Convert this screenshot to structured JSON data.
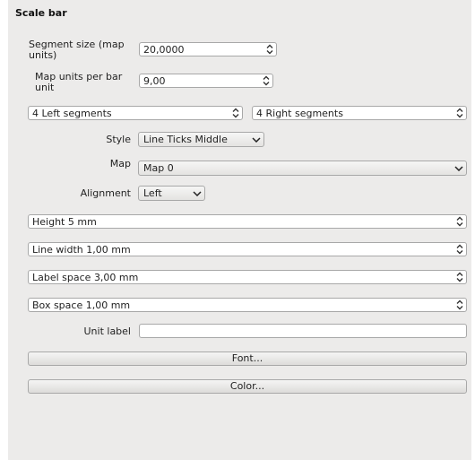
{
  "section": {
    "title": "Scale bar"
  },
  "segment_size": {
    "label": "Segment size (map units)",
    "value": "20,0000"
  },
  "map_units_per_bar": {
    "label": "Map units per bar unit",
    "value": "9,00"
  },
  "segments": {
    "left": "4 Left segments",
    "right": "4 Right segments"
  },
  "style": {
    "label": "Style",
    "value": "Line Ticks Middle"
  },
  "map": {
    "label": "Map",
    "value": "Map 0"
  },
  "alignment": {
    "label": "Alignment",
    "value": "Left"
  },
  "height": {
    "value": "Height 5 mm"
  },
  "line_width": {
    "value": "Line width 1,00 mm"
  },
  "label_space": {
    "value": "Label space 3,00 mm"
  },
  "box_space": {
    "value": "Box space 1,00 mm"
  },
  "unit_label": {
    "label": "Unit label",
    "value": ""
  },
  "buttons": {
    "font": "Font...",
    "color": "Color..."
  },
  "icons": {
    "spinner": "up-down-arrows-icon",
    "dropdown": "chevron-down-icon"
  }
}
